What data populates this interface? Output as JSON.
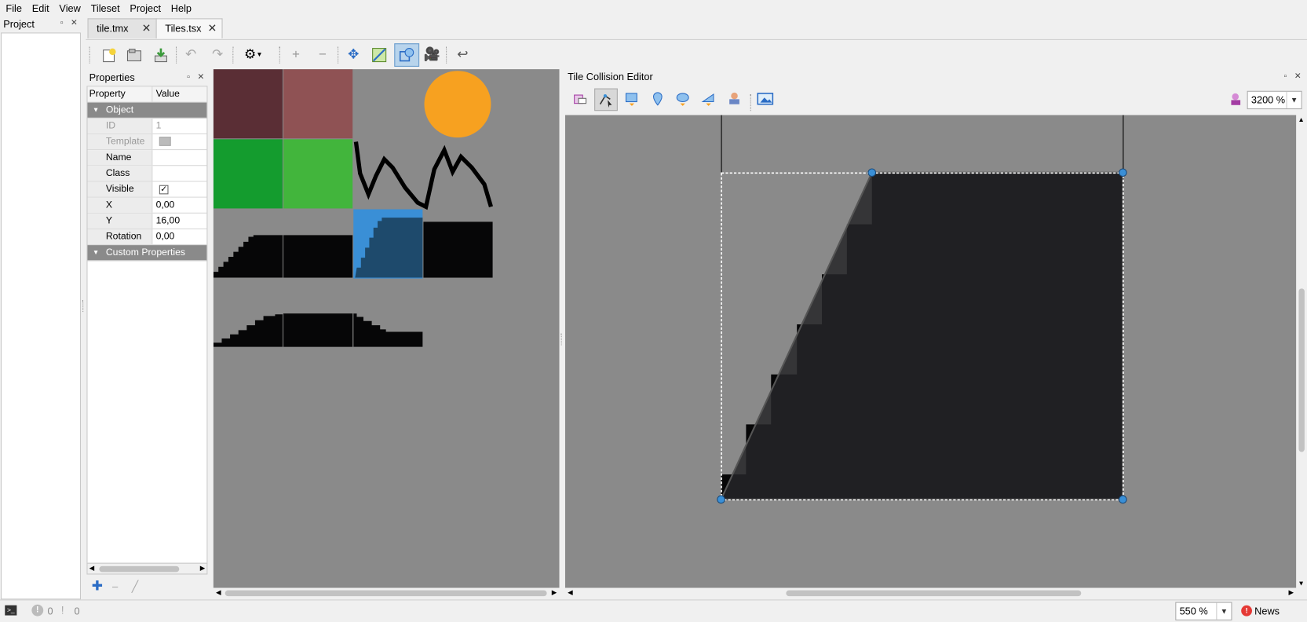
{
  "menu": [
    "File",
    "Edit",
    "View",
    "Tileset",
    "Project",
    "Help"
  ],
  "project_dock": {
    "title": "Project"
  },
  "tabs": [
    {
      "label": "tile.tmx",
      "active": false
    },
    {
      "label": "Tiles.tsx",
      "active": true
    }
  ],
  "properties": {
    "title": "Properties",
    "col_property": "Property",
    "col_value": "Value",
    "group_object": "Object",
    "rows": [
      {
        "key": "ID",
        "value": "1",
        "disabled": true
      },
      {
        "key": "Template",
        "value": "",
        "disabled": true
      },
      {
        "key": "Name",
        "value": ""
      },
      {
        "key": "Class",
        "value": ""
      },
      {
        "key": "Visible",
        "value": "✓"
      },
      {
        "key": "X",
        "value": "0,00"
      },
      {
        "key": "Y",
        "value": "16,00"
      },
      {
        "key": "Rotation",
        "value": "0,00"
      }
    ],
    "group_custom": "Custom Properties"
  },
  "collision_editor": {
    "title": "Tile Collision Editor",
    "zoom": "3200 %"
  },
  "status": {
    "zoom": "550 %",
    "errors": "0",
    "warnings": "0",
    "news": "News"
  },
  "colors": {
    "accent": "#3a8fd6",
    "selection": "#1e4a6c",
    "canvas_bg": "#8a8a8a",
    "tile_dark": "#222224"
  }
}
